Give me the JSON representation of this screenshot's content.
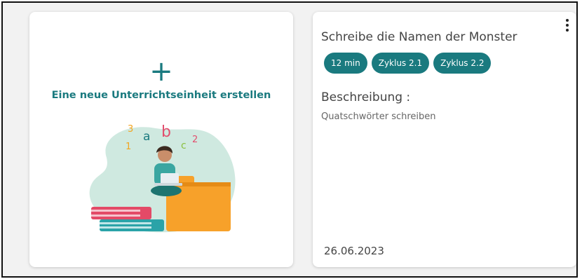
{
  "new_unit_card": {
    "plus_icon": "+",
    "title": "Eine neue Unterrichtseinheit erstellen",
    "illustration": {
      "letters": [
        "a",
        "b",
        "c"
      ],
      "digits": [
        "3",
        "1",
        "2"
      ]
    }
  },
  "lesson_card": {
    "title": "Schreibe die Namen der Monster",
    "tags": [
      "12 min",
      "Zyklus 2.1",
      "Zyklus 2.2"
    ],
    "description_label": "Beschreibung :",
    "description_text": "Quatschwörter schreiben",
    "date": "26.06.2023",
    "menu_icon": "more-vertical-icon"
  },
  "colors": {
    "accent": "#1a7a7f",
    "frame_bg": "#f2f2f2",
    "card_bg": "#ffffff"
  }
}
